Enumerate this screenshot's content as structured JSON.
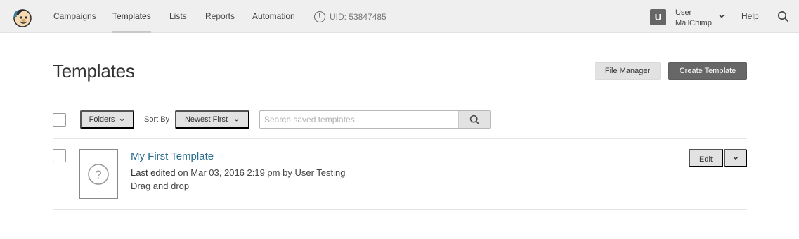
{
  "nav": {
    "items": [
      {
        "label": "Campaigns"
      },
      {
        "label": "Templates"
      },
      {
        "label": "Lists"
      },
      {
        "label": "Reports"
      },
      {
        "label": "Automation"
      }
    ],
    "active_item": "Templates",
    "uid": "UID: 53847485",
    "uid_icon": "!",
    "user": {
      "avatar_letter": "U",
      "name": "User",
      "account": "MailChimp"
    },
    "help_label": "Help"
  },
  "page": {
    "title": "Templates",
    "file_manager_label": "File Manager",
    "create_template_label": "Create Template"
  },
  "filters": {
    "folders_label": "Folders",
    "sort_by_label": "Sort By",
    "sort_value": "Newest First",
    "search_placeholder": "Search saved templates"
  },
  "templates": [
    {
      "name": "My First Template",
      "edited_label": "Last edited",
      "edited_detail": "on Mar 03, 2016 2:19 pm by User Testing",
      "type": "Drag and drop",
      "thumbnail_icon": "?",
      "edit_label": "Edit"
    }
  ],
  "colors": {
    "nav_bg": "#efefef",
    "link": "#2b6d8f",
    "primary_button": "#676767",
    "secondary_button": "#e2e2e2"
  }
}
